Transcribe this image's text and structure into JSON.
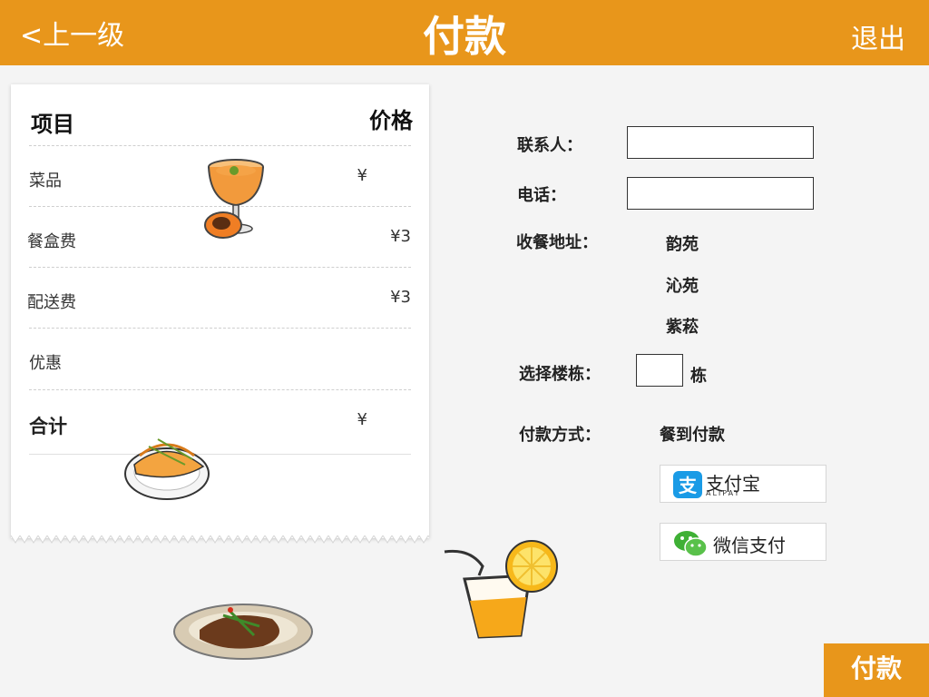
{
  "header": {
    "back_label": "<上一级",
    "title": "付款",
    "exit_label": "退出",
    "accent_color": "#e8961b"
  },
  "receipt": {
    "col_item": "项目",
    "col_price": "价格",
    "rows": [
      {
        "label": "菜品",
        "value": "¥"
      },
      {
        "label": "餐盒费",
        "value": "¥3"
      },
      {
        "label": "配送费",
        "value": "¥3"
      },
      {
        "label": "优惠",
        "value": ""
      }
    ],
    "total_label": "合计",
    "total_value": "¥"
  },
  "form": {
    "contact_label": "联系人：",
    "contact_value": "",
    "phone_label": "电话：",
    "phone_value": "",
    "address_label": "收餐地址：",
    "addresses": [
      "韵苑",
      "沁苑",
      "紫菘"
    ],
    "building_label": "选择楼栋：",
    "building_value": "",
    "building_unit": "栋",
    "payment_label": "付款方式：",
    "payment_options": {
      "cash": "餐到付款",
      "alipay": "支付宝",
      "alipay_sub": "ALIPAY",
      "wechat": "微信支付"
    }
  },
  "footer": {
    "pay_button": "付款"
  },
  "icons": [
    "back-icon",
    "alipay-icon",
    "wechat-pay-icon"
  ]
}
